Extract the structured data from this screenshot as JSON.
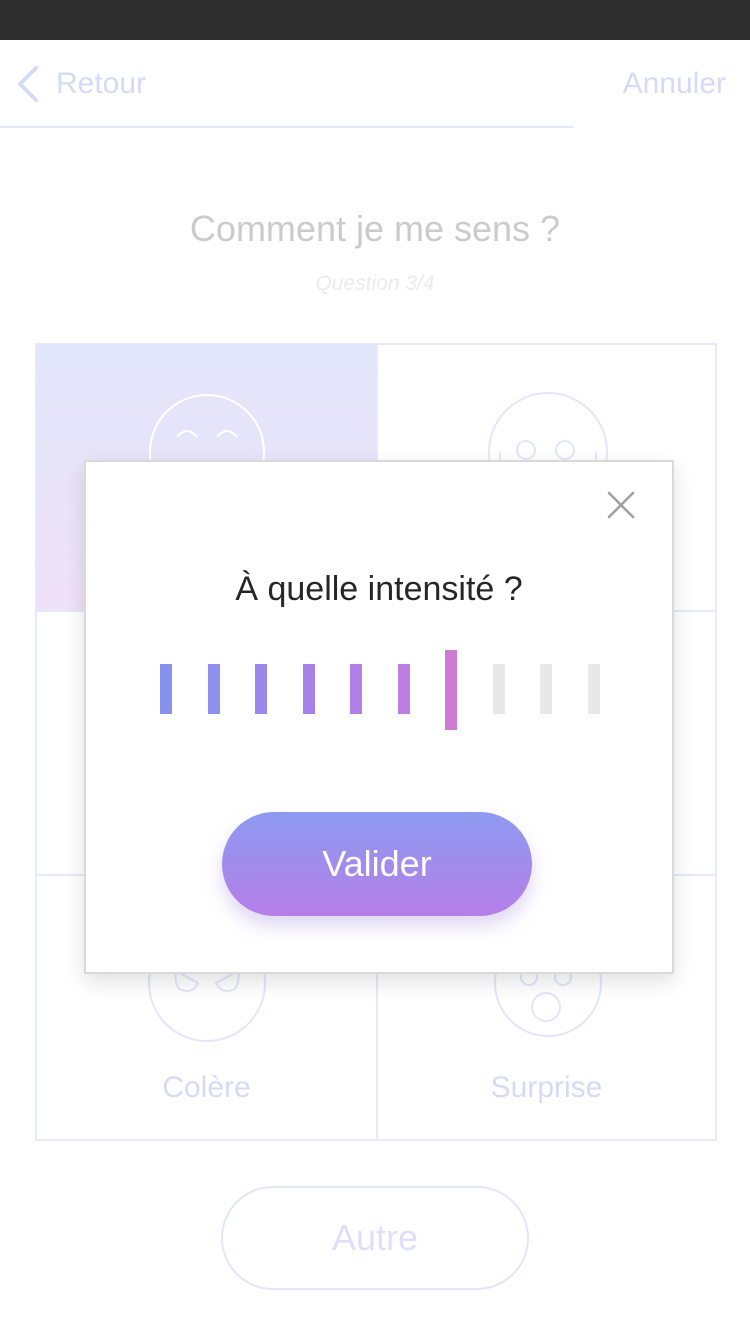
{
  "nav": {
    "back_label": "Retour",
    "cancel_label": "Annuler"
  },
  "page": {
    "title": "Comment je me sens ?",
    "subtitle": "Question  3/4"
  },
  "emotions": {
    "anger_label": "Colère",
    "surprise_label": "Surprise"
  },
  "other_label": "Autre",
  "modal": {
    "title": "À quelle intensité ?",
    "validate_label": "Valider",
    "intensity": {
      "selected": 7,
      "max": 10
    },
    "active_colors": [
      "#8792ec",
      "#8f91ec",
      "#9a88ec",
      "#a581ea",
      "#b27fe8",
      "#be7fe4",
      "#cf7bd6"
    ],
    "inactive_color": "#e8e8e8"
  }
}
